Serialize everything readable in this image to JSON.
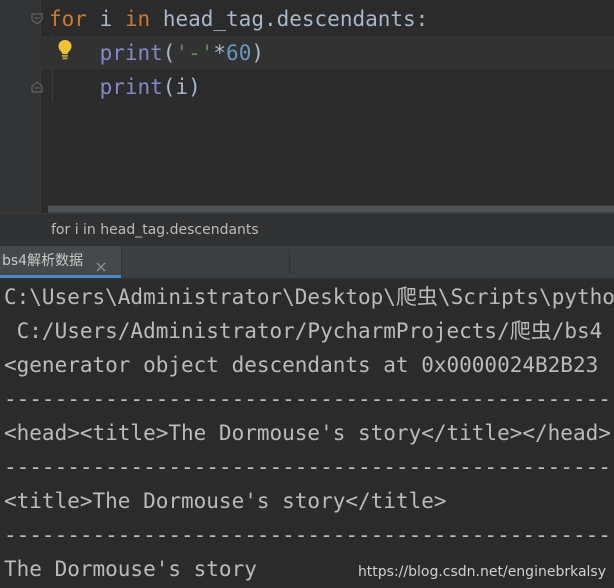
{
  "editor": {
    "lines": [
      {
        "tokens": [
          {
            "cls": "kw",
            "text": "for"
          },
          {
            "cls": "plain",
            "text": " i "
          },
          {
            "cls": "kw",
            "text": "in"
          },
          {
            "cls": "plain",
            "text": " head_tag.descendants:"
          }
        ]
      },
      {
        "tokens": [
          {
            "cls": "plain",
            "text": "    "
          },
          {
            "cls": "fn",
            "text": "print"
          },
          {
            "cls": "plain",
            "text": "("
          },
          {
            "cls": "str",
            "text": "'-'"
          },
          {
            "cls": "plain",
            "text": "*"
          },
          {
            "cls": "num",
            "text": "60"
          },
          {
            "cls": "plain",
            "text": ")"
          }
        ]
      },
      {
        "tokens": [
          {
            "cls": "plain",
            "text": "    "
          },
          {
            "cls": "fn",
            "text": "print"
          },
          {
            "cls": "plain",
            "text": "(i)"
          }
        ]
      }
    ],
    "intention_icon": "lightbulb-icon"
  },
  "breadcrumb": {
    "text": "for i in head_tag.descendants"
  },
  "run_panel": {
    "tab_label": "bs4解析数据",
    "tab_close_icon": "close-icon",
    "accent_color": "#4a88c7"
  },
  "console": {
    "lines": [
      "C:\\Users\\Administrator\\Desktop\\爬虫\\Scripts\\python.exe",
      " C:/Users/Administrator/PycharmProjects/爬虫/bs4",
      "<generator object descendants at 0x0000024B2B23",
      "------------------------------------------------------------",
      "<head><title>The Dormouse's story</title></head>",
      "------------------------------------------------------------",
      "<title>The Dormouse's story</title>",
      "------------------------------------------------------------",
      "The Dormouse's story"
    ]
  },
  "watermark": "https://blog.csdn.net/enginebrkalsy"
}
